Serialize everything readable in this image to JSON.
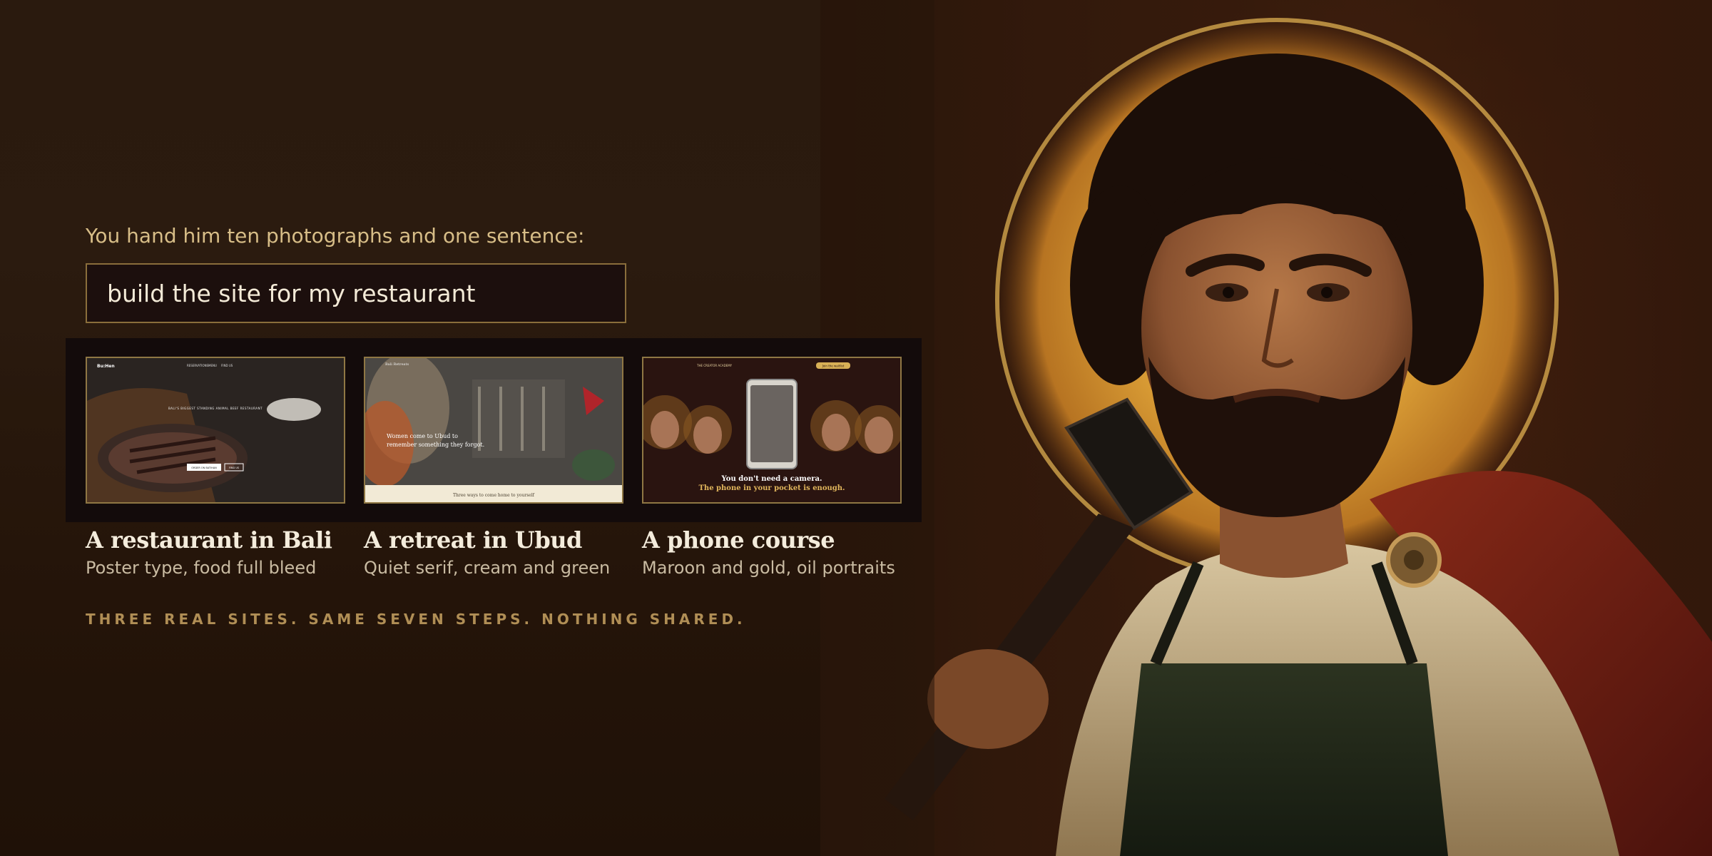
{
  "intro": "You hand him ten photographs and one sentence:",
  "prompt": "build the site for my restaurant",
  "cards": [
    {
      "title": "A restaurant in Bali",
      "subtitle": "Poster type, food full bleed",
      "preview": {
        "logo": "Bu:Hen",
        "nav": [
          "RESERVATIONS",
          "MENU",
          "FIND US"
        ],
        "headline": "BALI'S BIGGEST STANDING ANIMAL BEEF RESTAURANT",
        "buttons": [
          "ORDER ON BATIHAN",
          "FIND US"
        ]
      }
    },
    {
      "title": "A retreat in Ubud",
      "subtitle": "Quiet serif, cream and green",
      "preview": {
        "logo": "Bali Retreats",
        "headline_lines": [
          "Women come to Ubud to",
          "remember something they forgot."
        ],
        "footer": "Three ways to come home to yourself"
      }
    },
    {
      "title": "A phone course",
      "subtitle": "Maroon and gold, oil portraits",
      "preview": {
        "logo": "THE CREATOR ACADEMY",
        "cta": "Join the waitlist",
        "headline": "You don't need a camera.",
        "subline": "The phone in your pocket is enough."
      }
    }
  ],
  "footer": "THREE REAL SITES. SAME SEVEN STEPS. NOTHING SHARED.",
  "colors": {
    "background": "#2a1a0e",
    "gold_accent": "#b08e55",
    "border_gold": "#8a6e3b",
    "cream_text": "#f4ecdc"
  }
}
